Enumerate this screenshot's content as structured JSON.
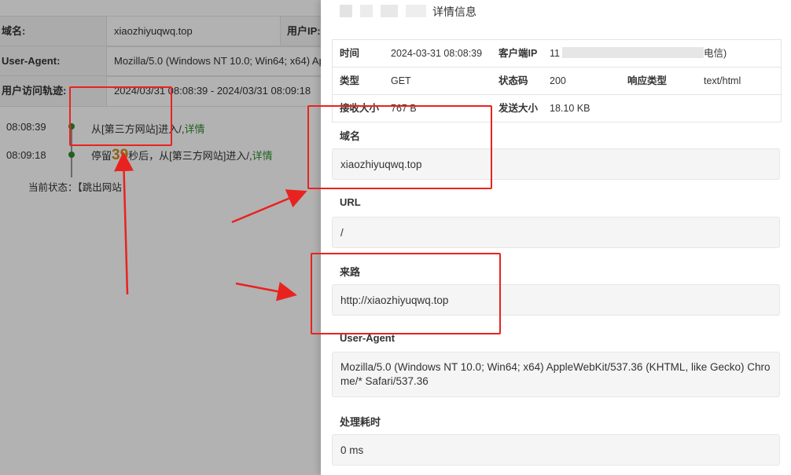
{
  "background": {
    "rows": [
      {
        "label": "域名:",
        "value": "xiaozhiyuqwq.top",
        "label2": "用户IP:"
      },
      {
        "label": "User-Agent:",
        "value": "Mozilla/5.0 (Windows NT 10.0; Win64; x64) Ap"
      },
      {
        "label": "用户访问轨迹:",
        "value": "2024/03/31 08:08:39 - 2024/03/31 08:09:18"
      }
    ],
    "timeline": [
      {
        "time": "08:08:39",
        "text": "从[第三方网站]进入/,",
        "link": "详情"
      },
      {
        "time": "08:09:18",
        "pre": "停留",
        "seconds": "39",
        "post": "秒后，从[第三方网站]进入/,",
        "link": "详情"
      }
    ],
    "status": "当前状态：【跳出网站"
  },
  "drawer": {
    "title": "详情信息",
    "info": {
      "time_label": "时间",
      "time_value": "2024-03-31 08:08:39",
      "ip_label": "客户端IP",
      "ip_prefix": "11",
      "ip_suffix": "电信)",
      "type_label": "类型",
      "type_value": "GET",
      "status_label": "状态码",
      "status_value": "200",
      "resp_label": "响应类型",
      "resp_value": "text/html",
      "recv_label": "接收大小",
      "recv_value": "767 B",
      "send_label": "发送大小",
      "send_value": "18.10 KB"
    },
    "sections": [
      {
        "label": "域名",
        "value": "xiaozhiyuqwq.top"
      },
      {
        "label": "URL",
        "value": "/"
      },
      {
        "label": "来路",
        "value": "http://xiaozhiyuqwq.top"
      },
      {
        "label": "User-Agent",
        "value": "Mozilla/5.0 (Windows NT 10.0; Win64; x64) AppleWebKit/537.36 (KHTML, like Gecko) Chrome/* Safari/537.36"
      },
      {
        "label": "处理耗时",
        "value": "0 ms"
      }
    ]
  },
  "colors": {
    "annotation": "#e8231f",
    "link": "#2e8b2e",
    "highlight": "#d08a1c"
  }
}
